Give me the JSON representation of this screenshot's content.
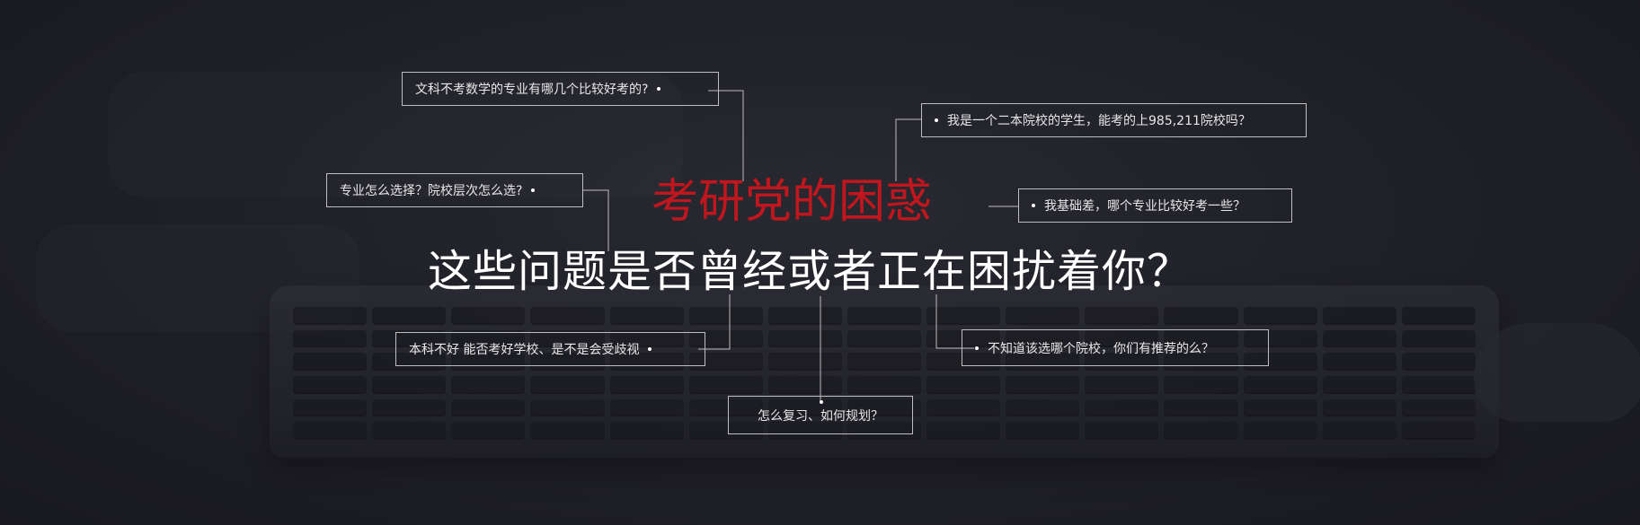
{
  "title": "这些问题是否曾经或者正在困扰着你？",
  "subtitle": "考研党的困惑",
  "questions": [
    "文科不考数学的专业有哪几个比较好考的?",
    "专业怎么选择？院校层次怎么选?",
    "本科不好 能否考好学校、是不是会受歧视",
    "怎么复习、如何规划？",
    "我是一个二本院校的学生，能考的上985,211院校吗？",
    "我基础差，哪个专业比较好考一些？",
    "不知道该选哪个院校，你们有推荐的么？"
  ],
  "colors": {
    "accent": "#c0161d",
    "text": "#ffffff",
    "box_border": "#bfbfbf"
  }
}
